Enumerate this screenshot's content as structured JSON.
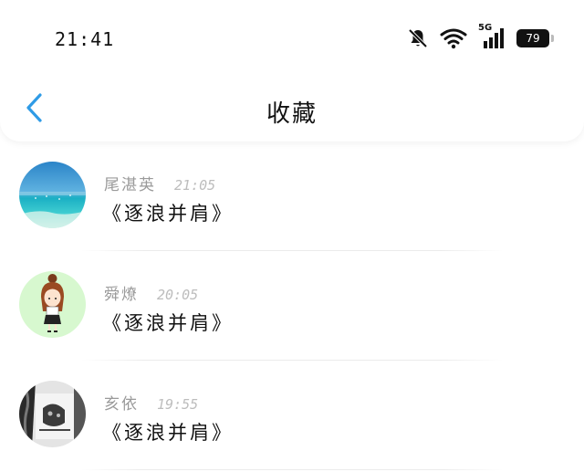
{
  "status_bar": {
    "time": "21:41",
    "signal_label": "5G",
    "battery": "79",
    "icons": [
      "bell-muted-icon",
      "wifi-icon",
      "cellular-signal-icon",
      "battery-icon"
    ]
  },
  "header": {
    "title": "收藏",
    "back_icon": "chevron-left-icon",
    "accent_color": "#2f9be6"
  },
  "favorites": [
    {
      "name": "尾湛英",
      "time": "21:05",
      "title": "《逐浪并肩》",
      "avatar": "ocean-avatar"
    },
    {
      "name": "舜燎",
      "time": "20:05",
      "title": "《逐浪并肩》",
      "avatar": "cartoon-girl-avatar"
    },
    {
      "name": "亥依",
      "time": "19:55",
      "title": "《逐浪并肩》",
      "avatar": "photo-avatar"
    }
  ]
}
